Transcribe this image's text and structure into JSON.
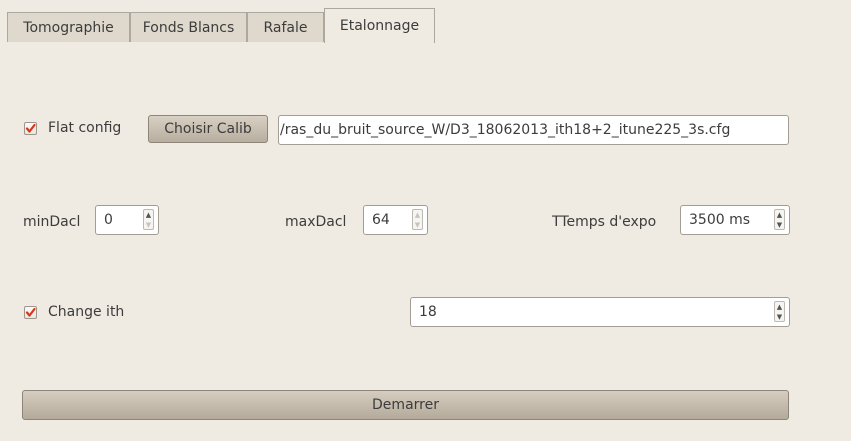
{
  "tabs": [
    {
      "label": "Tomographie",
      "active": false
    },
    {
      "label": "Fonds Blancs",
      "active": false
    },
    {
      "label": "Rafale",
      "active": false
    },
    {
      "label": "Etalonnage",
      "active": true
    }
  ],
  "flat_config": {
    "checked": true,
    "label": "Flat config",
    "button_label": "Choisir Calib",
    "path": "/ras_du_bruit_source_W/D3_18062013_ith18+2_itune225_3s.cfg"
  },
  "min_dacl": {
    "label": "minDacl",
    "value": "0"
  },
  "max_dacl": {
    "label": "maxDacl",
    "value": "64"
  },
  "exposure": {
    "label": "TTemps d'expo",
    "value": "3500 ms"
  },
  "change_ith": {
    "checked": true,
    "label": "Change ith",
    "value": "18"
  },
  "start_button": {
    "label": "Demarrer"
  },
  "colors": {
    "check_mark": "#d9371a",
    "background": "#f0ebe2",
    "button": "#c5bcae"
  }
}
